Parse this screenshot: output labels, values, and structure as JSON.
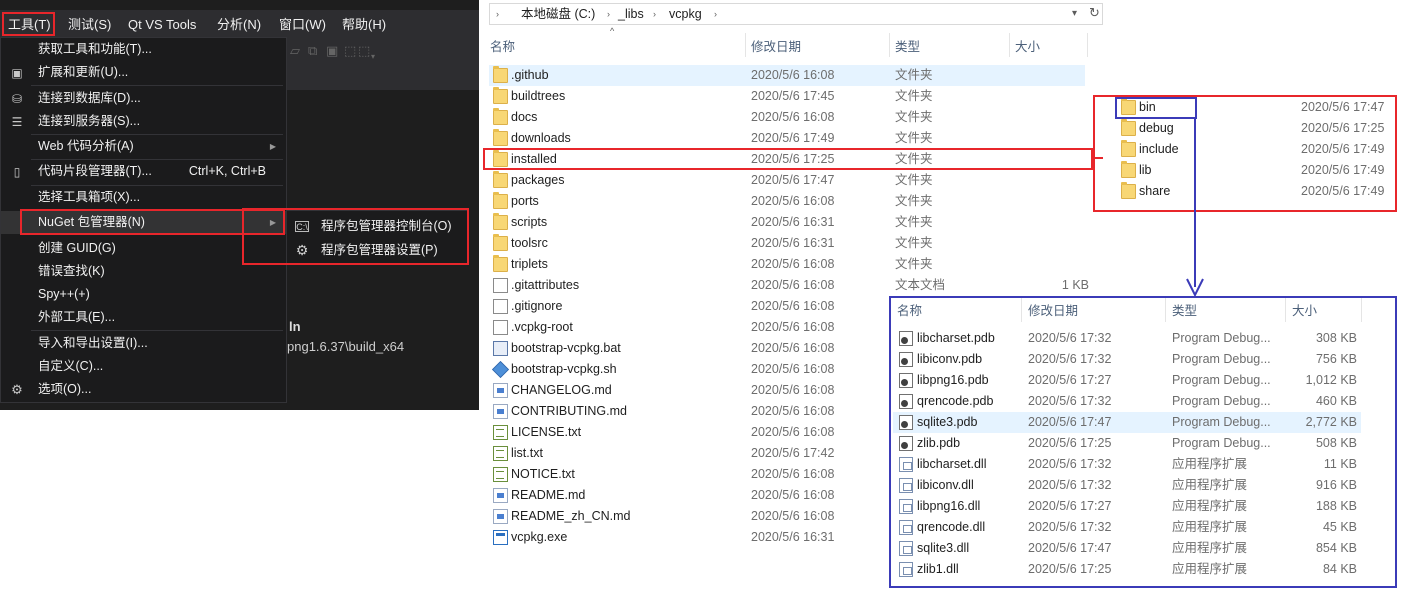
{
  "vs": {
    "menubar": [
      {
        "label": "工具(T)"
      },
      {
        "label": "测试(S)"
      },
      {
        "label": "Qt VS Tools"
      },
      {
        "label": "分析(N)"
      },
      {
        "label": "窗口(W)"
      },
      {
        "label": "帮助(H)"
      }
    ],
    "editor": {
      "line1": "ln",
      "line2": "png1.6.37\\build_x64"
    },
    "tools_menu": [
      {
        "label": "获取工具和功能(T)...",
        "icon": "none"
      },
      {
        "label": "扩展和更新(U)...",
        "icon": "extensions-icon"
      },
      {
        "label": "连接到数据库(D)...",
        "icon": "database-icon"
      },
      {
        "label": "连接到服务器(S)...",
        "icon": "server-icon"
      },
      {
        "label": "Web 代码分析(A)",
        "icon": "none",
        "submenu": true
      },
      {
        "label": "代码片段管理器(T)...",
        "icon": "snippet-icon",
        "shortcut": "Ctrl+K, Ctrl+B"
      },
      {
        "label": "选择工具箱项(X)...",
        "icon": "none"
      },
      {
        "label": "NuGet 包管理器(N)",
        "icon": "none",
        "submenu": true
      },
      {
        "label": "创建 GUID(G)",
        "icon": "none"
      },
      {
        "label": "错误查找(K)",
        "icon": "none"
      },
      {
        "label": "Spy++(+)",
        "icon": "none"
      },
      {
        "label": "外部工具(E)...",
        "icon": "none"
      },
      {
        "label": "导入和导出设置(I)...",
        "icon": "none"
      },
      {
        "label": "自定义(C)...",
        "icon": "none"
      },
      {
        "label": "选项(O)...",
        "icon": "gear-icon"
      }
    ],
    "nuget_submenu": [
      {
        "label": "程序包管理器控制台(O)",
        "icon": "console-icon"
      },
      {
        "label": "程序包管理器设置(P)",
        "icon": "gear-icon"
      }
    ]
  },
  "explorer": {
    "breadcrumb": [
      "本地磁盘 (C:)",
      "_libs",
      "vcpkg"
    ],
    "columns": {
      "name": "名称",
      "date": "修改日期",
      "type": "类型",
      "size": "大小"
    },
    "rows": [
      {
        "name": ".github",
        "date": "2020/5/6 16:08",
        "type": "文件夹",
        "size": "",
        "icon": "folder"
      },
      {
        "name": "buildtrees",
        "date": "2020/5/6 17:45",
        "type": "文件夹",
        "size": "",
        "icon": "folder"
      },
      {
        "name": "docs",
        "date": "2020/5/6 16:08",
        "type": "文件夹",
        "size": "",
        "icon": "folder"
      },
      {
        "name": "downloads",
        "date": "2020/5/6 17:49",
        "type": "文件夹",
        "size": "",
        "icon": "folder"
      },
      {
        "name": "installed",
        "date": "2020/5/6 17:25",
        "type": "文件夹",
        "size": "",
        "icon": "folder"
      },
      {
        "name": "packages",
        "date": "2020/5/6 17:47",
        "type": "文件夹",
        "size": "",
        "icon": "folder"
      },
      {
        "name": "ports",
        "date": "2020/5/6 16:08",
        "type": "文件夹",
        "size": "",
        "icon": "folder"
      },
      {
        "name": "scripts",
        "date": "2020/5/6 16:31",
        "type": "文件夹",
        "size": "",
        "icon": "folder"
      },
      {
        "name": "toolsrc",
        "date": "2020/5/6 16:31",
        "type": "文件夹",
        "size": "",
        "icon": "folder"
      },
      {
        "name": "triplets",
        "date": "2020/5/6 16:08",
        "type": "文件夹",
        "size": "",
        "icon": "folder"
      },
      {
        "name": ".gitattributes",
        "date": "2020/5/6 16:08",
        "type": "文本文档",
        "size": "1 KB",
        "icon": "file"
      },
      {
        "name": ".gitignore",
        "date": "2020/5/6 16:08",
        "type": "",
        "size": "",
        "icon": "file"
      },
      {
        "name": ".vcpkg-root",
        "date": "2020/5/6 16:08",
        "type": "",
        "size": "",
        "icon": "file"
      },
      {
        "name": "bootstrap-vcpkg.bat",
        "date": "2020/5/6 16:08",
        "type": "",
        "size": "",
        "icon": "file-bat"
      },
      {
        "name": "bootstrap-vcpkg.sh",
        "date": "2020/5/6 16:08",
        "type": "",
        "size": "",
        "icon": "file-sh"
      },
      {
        "name": "CHANGELOG.md",
        "date": "2020/5/6 16:08",
        "type": "",
        "size": "",
        "icon": "file-md"
      },
      {
        "name": "CONTRIBUTING.md",
        "date": "2020/5/6 16:08",
        "type": "",
        "size": "",
        "icon": "file-md"
      },
      {
        "name": "LICENSE.txt",
        "date": "2020/5/6 16:08",
        "type": "",
        "size": "",
        "icon": "file-txt"
      },
      {
        "name": "list.txt",
        "date": "2020/5/6 17:42",
        "type": "",
        "size": "",
        "icon": "file-txt"
      },
      {
        "name": "NOTICE.txt",
        "date": "2020/5/6 16:08",
        "type": "",
        "size": "",
        "icon": "file-txt"
      },
      {
        "name": "README.md",
        "date": "2020/5/6 16:08",
        "type": "",
        "size": "",
        "icon": "file-md"
      },
      {
        "name": "README_zh_CN.md",
        "date": "2020/5/6 16:08",
        "type": "",
        "size": "",
        "icon": "file-md"
      },
      {
        "name": "vcpkg.exe",
        "date": "2020/5/6 16:31",
        "type": "",
        "size": "",
        "icon": "file-exe"
      }
    ]
  },
  "installed_panel": {
    "rows": [
      {
        "name": "bin",
        "date": "2020/5/6 17:47"
      },
      {
        "name": "debug",
        "date": "2020/5/6 17:25"
      },
      {
        "name": "include",
        "date": "2020/5/6 17:49"
      },
      {
        "name": "lib",
        "date": "2020/5/6 17:49"
      },
      {
        "name": "share",
        "date": "2020/5/6 17:49"
      }
    ]
  },
  "bin_panel": {
    "columns": {
      "name": "名称",
      "date": "修改日期",
      "type": "类型",
      "size": "大小"
    },
    "rows": [
      {
        "name": "libcharset.pdb",
        "date": "2020/5/6 17:32",
        "type": "Program Debug...",
        "size": "308 KB",
        "icon": "file-pdb"
      },
      {
        "name": "libiconv.pdb",
        "date": "2020/5/6 17:32",
        "type": "Program Debug...",
        "size": "756 KB",
        "icon": "file-pdb"
      },
      {
        "name": "libpng16.pdb",
        "date": "2020/5/6 17:27",
        "type": "Program Debug...",
        "size": "1,012 KB",
        "icon": "file-pdb"
      },
      {
        "name": "qrencode.pdb",
        "date": "2020/5/6 17:32",
        "type": "Program Debug...",
        "size": "460 KB",
        "icon": "file-pdb"
      },
      {
        "name": "sqlite3.pdb",
        "date": "2020/5/6 17:47",
        "type": "Program Debug...",
        "size": "2,772 KB",
        "icon": "file-pdb"
      },
      {
        "name": "zlib.pdb",
        "date": "2020/5/6 17:25",
        "type": "Program Debug...",
        "size": "508 KB",
        "icon": "file-pdb"
      },
      {
        "name": "libcharset.dll",
        "date": "2020/5/6 17:32",
        "type": "应用程序扩展",
        "size": "11 KB",
        "icon": "file-dll"
      },
      {
        "name": "libiconv.dll",
        "date": "2020/5/6 17:32",
        "type": "应用程序扩展",
        "size": "916 KB",
        "icon": "file-dll"
      },
      {
        "name": "libpng16.dll",
        "date": "2020/5/6 17:27",
        "type": "应用程序扩展",
        "size": "188 KB",
        "icon": "file-dll"
      },
      {
        "name": "qrencode.dll",
        "date": "2020/5/6 17:32",
        "type": "应用程序扩展",
        "size": "45 KB",
        "icon": "file-dll"
      },
      {
        "name": "sqlite3.dll",
        "date": "2020/5/6 17:47",
        "type": "应用程序扩展",
        "size": "854 KB",
        "icon": "file-dll"
      },
      {
        "name": "zlib1.dll",
        "date": "2020/5/6 17:25",
        "type": "应用程序扩展",
        "size": "84 KB",
        "icon": "file-dll"
      }
    ]
  },
  "colors": {
    "annotation_red": "#e8262b",
    "annotation_blue": "#3b3bb8",
    "vs_menu_bg": "#1b1b1c",
    "selection": "#e5f3ff"
  }
}
